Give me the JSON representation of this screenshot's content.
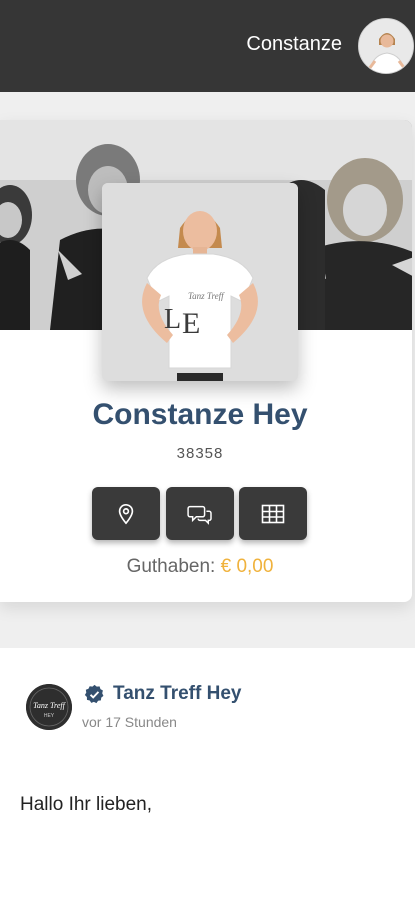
{
  "header": {
    "username": "Constanze"
  },
  "profile": {
    "full_name": "Constanze Hey",
    "member_number": "38358",
    "balance_label": "Guthaben:",
    "balance_amount": "€ 0,00"
  },
  "actions": [
    {
      "icon": "location-pin-icon"
    },
    {
      "icon": "chat-bubbles-icon"
    },
    {
      "icon": "grid-table-icon"
    }
  ],
  "post": {
    "author": "Tanz Treff Hey",
    "time": "vor 17 Stunden",
    "text": "Hallo Ihr lieben,",
    "logo_text": "Tanz Treff",
    "logo_subtext": "HEY"
  },
  "colors": {
    "header_bg": "#363636",
    "name_blue": "#34506f",
    "amount_gold": "#f0b23c",
    "button_dark": "#3a3a3a"
  }
}
